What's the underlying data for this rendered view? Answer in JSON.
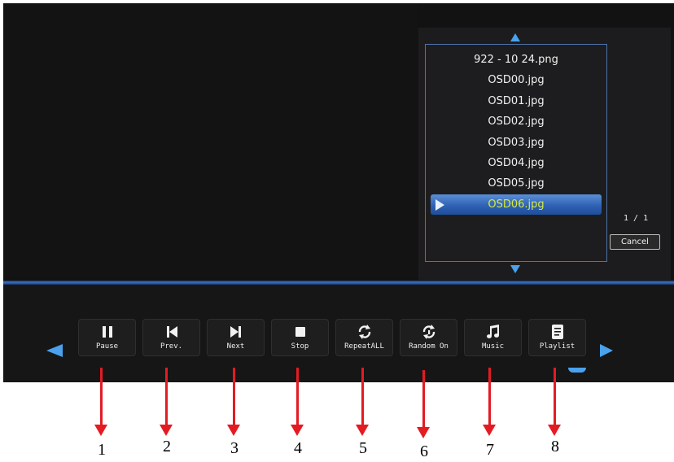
{
  "playlist": {
    "files": [
      {
        "name": "922 - 10 24.png",
        "selected": false
      },
      {
        "name": "OSD00.jpg",
        "selected": false
      },
      {
        "name": "OSD01.jpg",
        "selected": false
      },
      {
        "name": "OSD02.jpg",
        "selected": false
      },
      {
        "name": "OSD03.jpg",
        "selected": false
      },
      {
        "name": "OSD04.jpg",
        "selected": false
      },
      {
        "name": "OSD05.jpg",
        "selected": false
      },
      {
        "name": "OSD06.jpg",
        "selected": true
      }
    ],
    "page_indicator": "1 / 1",
    "cancel_label": "Cancel"
  },
  "controls": [
    {
      "id": "pause",
      "label": "Pause",
      "icon": "pause-icon"
    },
    {
      "id": "prev",
      "label": "Prev.",
      "icon": "previous-icon"
    },
    {
      "id": "next",
      "label": "Next",
      "icon": "next-icon"
    },
    {
      "id": "stop",
      "label": "Stop",
      "icon": "stop-icon"
    },
    {
      "id": "repeat",
      "label": "RepeatALL",
      "icon": "repeat-icon"
    },
    {
      "id": "random",
      "label": "Random On",
      "icon": "shuffle-icon"
    },
    {
      "id": "music",
      "label": "Music",
      "icon": "music-note-icon"
    },
    {
      "id": "playlist",
      "label": "Playlist",
      "icon": "playlist-icon"
    }
  ],
  "annotations": [
    "1",
    "2",
    "3",
    "4",
    "5",
    "6",
    "7",
    "8"
  ],
  "colors": {
    "accent": "#4aa2ee",
    "selection_text": "#d7ea3c",
    "annotation": "#e31b23"
  }
}
